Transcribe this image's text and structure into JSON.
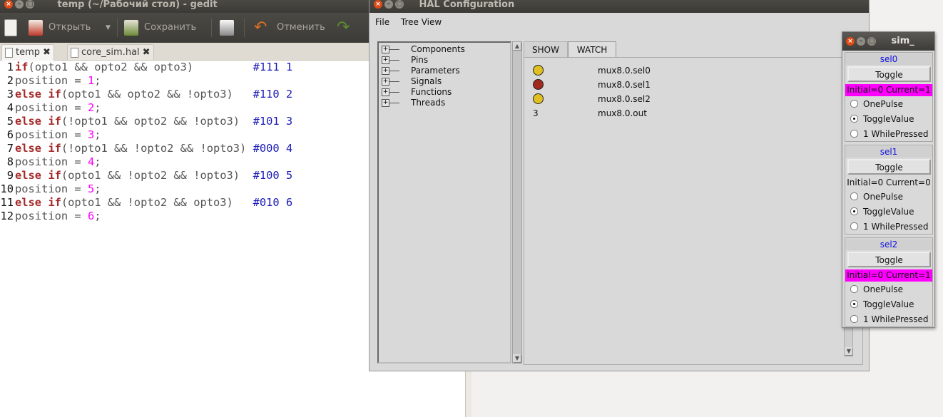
{
  "gedit": {
    "title": "temp (~/Рабочий стол) - gedit",
    "toolbar": {
      "open_label": "Открыть",
      "save_label": "Сохранить",
      "undo_label": "Отменить"
    },
    "tabs": [
      {
        "label": "temp",
        "active": true
      },
      {
        "label": "core_sim.hal",
        "active": false
      }
    ],
    "lines": [
      {
        "n": "1",
        "parts": [
          [
            "kw",
            "if"
          ],
          [
            "plain",
            "(opto1 && opto2 && opto3)         "
          ],
          [
            "cmt",
            "#111 1"
          ]
        ]
      },
      {
        "n": "2",
        "parts": [
          [
            "plain",
            "position = "
          ],
          [
            "num",
            "1"
          ],
          [
            "plain",
            ";"
          ]
        ]
      },
      {
        "n": "3",
        "parts": [
          [
            "kw",
            "else if"
          ],
          [
            "plain",
            "(opto1 && opto2 && !opto3)   "
          ],
          [
            "cmt",
            "#110 2"
          ]
        ]
      },
      {
        "n": "4",
        "parts": [
          [
            "plain",
            "position = "
          ],
          [
            "num",
            "2"
          ],
          [
            "plain",
            ";"
          ]
        ]
      },
      {
        "n": "5",
        "parts": [
          [
            "kw",
            "else if"
          ],
          [
            "plain",
            "(!opto1 && opto2 && !opto3)  "
          ],
          [
            "cmt",
            "#101 3"
          ]
        ]
      },
      {
        "n": "6",
        "parts": [
          [
            "plain",
            "position = "
          ],
          [
            "num",
            "3"
          ],
          [
            "plain",
            ";"
          ]
        ]
      },
      {
        "n": "7",
        "parts": [
          [
            "kw",
            "else if"
          ],
          [
            "plain",
            "(!opto1 && !opto2 && !opto3) "
          ],
          [
            "cmt",
            "#000 4"
          ]
        ]
      },
      {
        "n": "8",
        "parts": [
          [
            "plain",
            "position = "
          ],
          [
            "num",
            "4"
          ],
          [
            "plain",
            ";"
          ]
        ]
      },
      {
        "n": "9",
        "parts": [
          [
            "kw",
            "else if"
          ],
          [
            "plain",
            "(opto1 && !opto2 && !opto3)  "
          ],
          [
            "cmt",
            "#100 5"
          ]
        ]
      },
      {
        "n": "10",
        "parts": [
          [
            "plain",
            "position = "
          ],
          [
            "num",
            "5"
          ],
          [
            "plain",
            ";"
          ]
        ]
      },
      {
        "n": "11",
        "parts": [
          [
            "kw",
            "else if"
          ],
          [
            "plain",
            "(opto1 && !opto2 && opto3)   "
          ],
          [
            "cmt",
            "#010 6"
          ]
        ]
      },
      {
        "n": "12",
        "parts": [
          [
            "plain",
            "position = "
          ],
          [
            "num",
            "6"
          ],
          [
            "plain",
            ";"
          ]
        ]
      }
    ]
  },
  "hal": {
    "title": "HAL Configuration",
    "menu": {
      "file": "File",
      "tree_view": "Tree View"
    },
    "tree": [
      "Components",
      "Pins",
      "Parameters",
      "Signals",
      "Functions",
      "Threads"
    ],
    "tabs": {
      "show": "SHOW",
      "watch": "WATCH"
    },
    "watch": [
      {
        "kind": "led",
        "color": "#e0c020",
        "name": "mux8.0.sel0"
      },
      {
        "kind": "led",
        "color": "#a02a1e",
        "name": "mux8.0.sel1"
      },
      {
        "kind": "led",
        "color": "#e0c020",
        "name": "mux8.0.sel2"
      },
      {
        "kind": "value",
        "value": "3",
        "name": "mux8.0.out"
      }
    ]
  },
  "sim": {
    "title": "sim_",
    "groups": [
      {
        "pin": "sel0",
        "button": "Toggle",
        "status": "Initial=0 Current=1",
        "hot": true,
        "options": [
          "OnePulse",
          "ToggleValue",
          "1 WhilePressed"
        ],
        "selected": 1
      },
      {
        "pin": "sel1",
        "button": "Toggle",
        "status": "Initial=0 Current=0",
        "hot": false,
        "options": [
          "OnePulse",
          "ToggleValue",
          "1 WhilePressed"
        ],
        "selected": 1
      },
      {
        "pin": "sel2",
        "button": "Toggle",
        "status": "Initial=0 Current=1",
        "hot": true,
        "options": [
          "OnePulse",
          "ToggleValue",
          "1 WhilePressed"
        ],
        "selected": 1
      }
    ]
  },
  "colors": {
    "status_hot": "#ff00ff",
    "pin_label": "#1010e0"
  }
}
